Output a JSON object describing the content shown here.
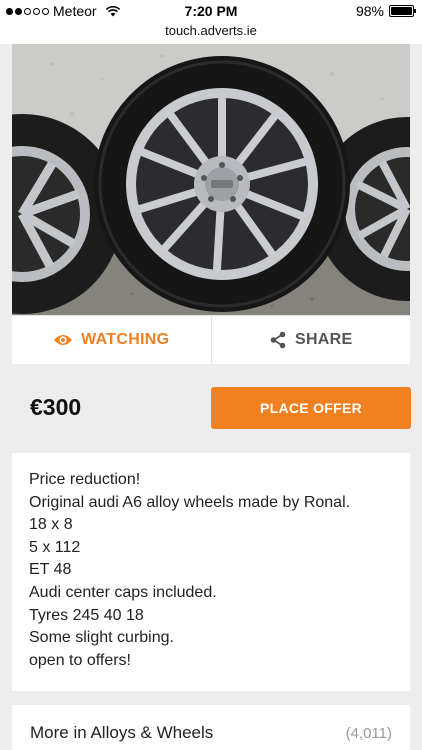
{
  "status_bar": {
    "carrier": "Meteor",
    "time": "7:20 PM",
    "battery": "98%",
    "battery_level": 0.98
  },
  "url_bar": {
    "url": "touch.adverts.ie"
  },
  "listing": {
    "actions": {
      "watching_label": "WATCHING",
      "share_label": "SHARE"
    },
    "price": "€300",
    "place_offer_label": "PLACE OFFER",
    "description_lines": [
      "Price reduction!",
      "Original audi A6 alloy wheels made by Ronal.",
      "18 x 8",
      "5 x 112",
      "ET 48",
      "Audi center caps included.",
      "Tyres 245 40 18",
      "Some slight curbing.",
      "open to offers!"
    ]
  },
  "more_section": {
    "title": "More in Alloys & Wheels",
    "count": "(4,011)"
  },
  "colors": {
    "accent": "#f08020",
    "background": "#ededed",
    "card": "#ffffff"
  },
  "icons": {
    "watching": "eye-icon",
    "share": "share-icon",
    "wifi": "wifi-icon",
    "battery": "battery-icon"
  }
}
